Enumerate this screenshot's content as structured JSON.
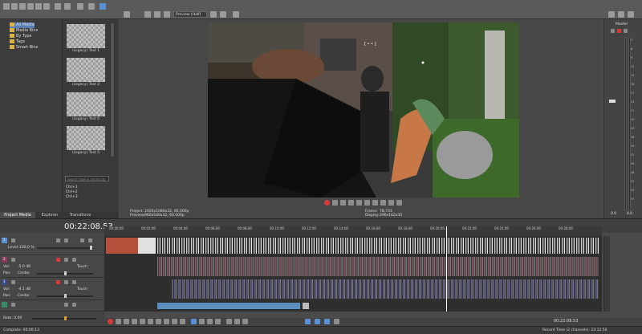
{
  "explorer": {
    "tree": [
      "All Media",
      "Media Bins",
      "By Type",
      "Tags",
      "Smart Bins"
    ]
  },
  "media": {
    "items": [
      "(Legacy) Text 1",
      "(Legacy) Text 2",
      "(Legacy) Text 6",
      "(Legacy) Text 5"
    ],
    "search_placeholder": "Search text & shortcuts",
    "shortcuts": [
      "Ctrl+1",
      "Ctrl+2",
      "Ctrl+3"
    ]
  },
  "tabs": [
    "Project Media",
    "Explorer",
    "Transitions"
  ],
  "preview": {
    "mode": "Preview (Half)",
    "overlay_text": "[ • • ]",
    "project_label": "Project:",
    "project_value": "1920x1080x32, 60.000p",
    "preview_label": "Preview:",
    "preview_value": "960x540x32, 60.000p",
    "frame_label": "Frame:",
    "frame_value": "78,733",
    "display_label": "Display:",
    "display_value": "296x162x32"
  },
  "master": {
    "title": "Master",
    "scale": [
      "3",
      "6",
      "9",
      "12",
      "15",
      "18",
      "21",
      "24",
      "27",
      "30",
      "33",
      "36",
      "39",
      "42",
      "45",
      "48",
      "51",
      "54",
      "57"
    ],
    "bottom": [
      "0.0",
      "0.0"
    ]
  },
  "timeline": {
    "timecode": "00:22:08.53",
    "ruler_labels": [
      "00:00:00",
      "00:02:00",
      "00:04:00",
      "00:06:00",
      "00:08:00",
      "00:10:00",
      "00:12:00",
      "00:14:00",
      "00:16:00",
      "00:18:00",
      "00:20:00",
      "00:22:00",
      "00:24:00",
      "00:26:00",
      "00:28:00"
    ],
    "video_track": {
      "number": "1",
      "level_label": "Level:",
      "level_value": "100.0 %"
    },
    "audio_tracks": [
      {
        "number": "2",
        "vol_label": "Vol:",
        "vol_value": "-5.0 dB",
        "pan_label": "Pan:",
        "pan_value": "Center",
        "mode": "Touch"
      },
      {
        "number": "3",
        "vol_label": "Vol:",
        "vol_value": "-4.1 dB",
        "pan_label": "Pan:",
        "pan_value": "Center",
        "mode": "Touch"
      }
    ],
    "rate_label": "Rate: 0.00"
  },
  "status": {
    "left": "Complete: 00:00:13",
    "timecode": "00:22:08.53",
    "record_time": "Record Time (2 channels): 23:12:50"
  },
  "colors": {
    "accent": "#5b8fd6",
    "record": "#d83a3a",
    "background": "#4a4a4a"
  }
}
